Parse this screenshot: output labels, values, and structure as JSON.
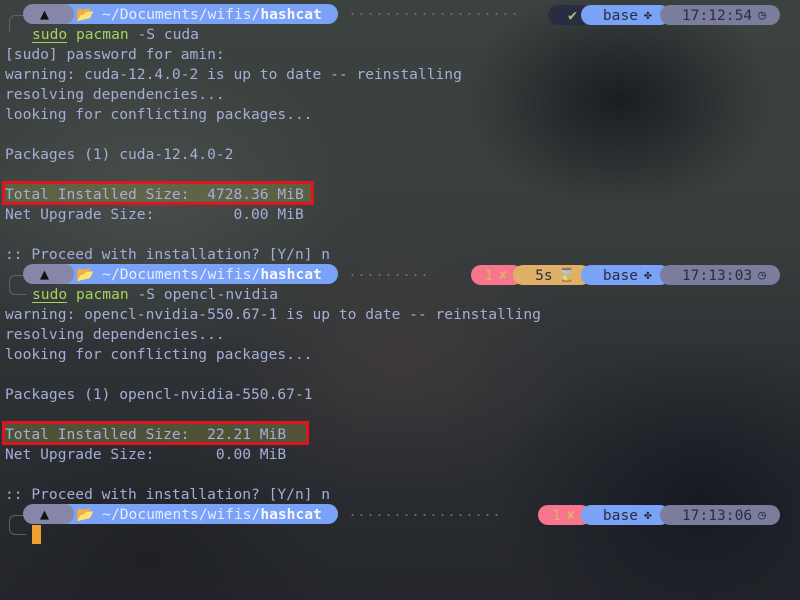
{
  "terminal": {
    "prompts": [
      {
        "os_icon": "arch-linux-icon",
        "path_prefix": "~/Documents/wifis/",
        "path_current": "hashcat",
        "status": {
          "type": "success",
          "icon": "checkmark-icon",
          "glyph": "✔"
        },
        "duration": null,
        "env": "base",
        "env_icon": "python-icon",
        "time": "17:12:54",
        "time_icon": "clock-icon",
        "command": {
          "sudo": "sudo",
          "program": "pacman",
          "args": " -S cuda"
        }
      },
      {
        "os_icon": "arch-linux-icon",
        "path_prefix": "~/Documents/wifis/",
        "path_current": "hashcat",
        "status": {
          "type": "error",
          "code": "1",
          "glyph": "✘"
        },
        "duration": {
          "value": "5s",
          "icon": "hourglass-icon",
          "glyph": "⌛"
        },
        "env": "base",
        "env_icon": "python-icon",
        "time": "17:13:03",
        "time_icon": "clock-icon",
        "command": {
          "sudo": "sudo",
          "program": "pacman",
          "args": " -S opencl-nvidia"
        }
      },
      {
        "os_icon": "arch-linux-icon",
        "path_prefix": "~/Documents/wifis/",
        "path_current": "hashcat",
        "status": {
          "type": "error",
          "code": "1",
          "glyph": "✘"
        },
        "duration": null,
        "env": "base",
        "env_icon": "python-icon",
        "time": "17:13:06",
        "time_icon": "clock-icon",
        "command": null
      }
    ],
    "output1": [
      "[sudo] password for amin:",
      "warning: cuda-12.4.0-2 is up to date -- reinstalling",
      "resolving dependencies...",
      "looking for conflicting packages...",
      "",
      "Packages (1) cuda-12.4.0-2",
      "",
      "Total Installed Size:  4728.36 MiB",
      "Net Upgrade Size:         0.00 MiB",
      "",
      ":: Proceed with installation? [Y/n] n"
    ],
    "output2": [
      "warning: opencl-nvidia-550.67-1 is up to date -- reinstalling",
      "resolving dependencies...",
      "looking for conflicting packages...",
      "",
      "Packages (1) opencl-nvidia-550.67-1",
      "",
      "Total Installed Size:  22.21 MiB",
      "Net Upgrade Size:       0.00 MiB",
      "",
      ":: Proceed with installation? [Y/n] n"
    ]
  },
  "glyphs": {
    "arch": "⮝",
    "folder": "🗁",
    "python": "✤",
    "clock": "◷"
  },
  "colors": {
    "highlight_border": "#e0141c",
    "path_segment": "#7aa2f7",
    "os_segment": "#8586a8",
    "error_segment": "#f7768e",
    "duration_segment": "#e0af68",
    "time_segment": "#7a7d9c",
    "command_green": "#a6d35a",
    "cursor": "#f0a030"
  }
}
